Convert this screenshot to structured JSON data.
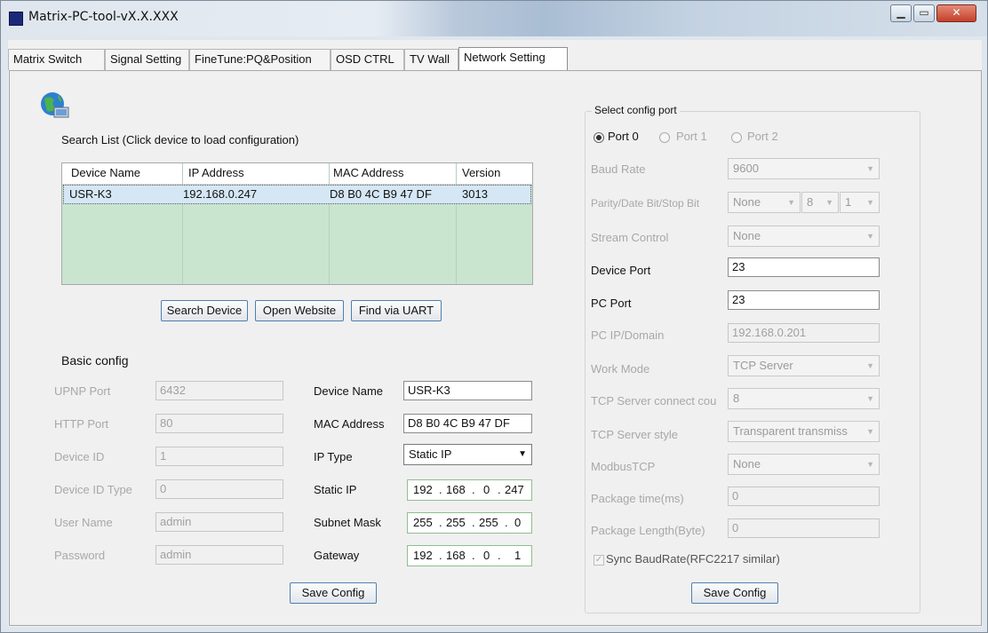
{
  "window": {
    "title": "Matrix-PC-tool-vX.X.XXX"
  },
  "tabs": [
    {
      "label": "Matrix Switch"
    },
    {
      "label": "Signal Setting"
    },
    {
      "label": "FineTune:PQ&Position"
    },
    {
      "label": "OSD CTRL"
    },
    {
      "label": "TV Wall"
    },
    {
      "label": "Network Setting",
      "active": true
    }
  ],
  "search": {
    "list_label": "Search List (Click device to load configuration)",
    "columns": [
      "Device Name",
      "IP Address",
      "MAC Address",
      "Version"
    ],
    "rows": [
      {
        "name": "USR-K3",
        "ip": "192.168.0.247",
        "mac": "D8 B0 4C B9 47 DF",
        "version": "3013"
      }
    ],
    "buttons": {
      "search": "Search Device",
      "open": "Open Website",
      "uart": "Find via UART"
    }
  },
  "basic": {
    "title": "Basic config",
    "upnp_label": "UPNP Port",
    "upnp_value": "6432",
    "http_label": "HTTP Port",
    "http_value": "80",
    "devid_label": "Device ID",
    "devid_value": "1",
    "devidtype_label": "Device ID Type",
    "devidtype_value": "0",
    "user_label": "User Name",
    "user_value": "admin",
    "pass_label": "Password",
    "pass_value": "admin",
    "devname_label": "Device Name",
    "devname_value": "USR-K3",
    "mac_label": "MAC Address",
    "mac_value": "D8 B0 4C B9 47 DF",
    "iptype_label": "IP Type",
    "iptype_value": "Static IP",
    "staticip_label": "Static IP",
    "staticip": [
      "192",
      "168",
      "0",
      "247"
    ],
    "mask_label": "Subnet Mask",
    "mask": [
      "255",
      "255",
      "255",
      "0"
    ],
    "gw_label": "Gateway",
    "gateway": [
      "192",
      "168",
      "0",
      "1"
    ],
    "save": "Save Config"
  },
  "port": {
    "title": "Select config port",
    "port0": "Port 0",
    "port1": "Port 1",
    "port2": "Port 2",
    "baud_label": "Baud Rate",
    "baud_value": "9600",
    "parity_label": "Parity/Date Bit/Stop Bit",
    "parity_value": "None",
    "databit_value": "8",
    "stopbit_value": "1",
    "stream_label": "Stream Control",
    "stream_value": "None",
    "devport_label": "Device Port",
    "devport_value": "23",
    "pcport_label": "PC Port",
    "pcport_value": "23",
    "pcip_label": "PC IP/Domain",
    "pcip_value": "192.168.0.201",
    "work_label": "Work Mode",
    "work_value": "TCP Server",
    "tcpconn_label": "TCP Server connect cou",
    "tcpconn_value": "8",
    "tcpstyle_label": "TCP Server style",
    "tcpstyle_value": "Transparent transmiss",
    "modbus_label": "ModbusTCP",
    "modbus_value": "None",
    "pkgtime_label": "Package time(ms)",
    "pkgtime_value": "0",
    "pkglen_label": "Package Length(Byte)",
    "pkglen_value": "0",
    "sync_label": "Sync BaudRate(RFC2217 similar)",
    "save": "Save Config"
  }
}
